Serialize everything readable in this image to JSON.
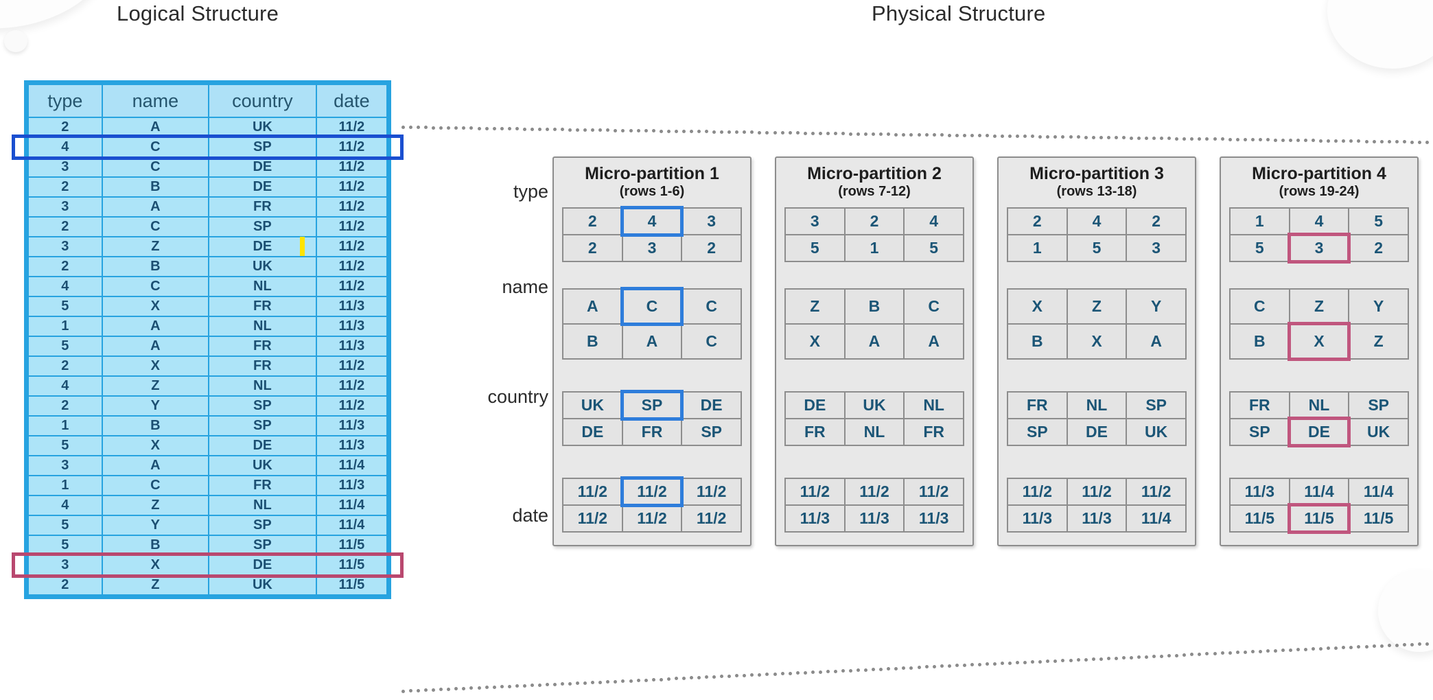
{
  "titles": {
    "logical": "Logical Structure",
    "physical": "Physical Structure"
  },
  "colors": {
    "table_border": "#27a3e0",
    "table_cell": "#ade4f8",
    "table_text": "#1b4f72",
    "highlight_blue": "#1a4fd0",
    "highlight_pink": "#b9486f",
    "partition_bg": "#e8e8e8",
    "caret_yellow": "#ffe400"
  },
  "logical_table": {
    "columns": [
      "type",
      "name",
      "country",
      "date"
    ],
    "rows": [
      {
        "type": "2",
        "name": "A",
        "country": "UK",
        "date": "11/2",
        "highlight": ""
      },
      {
        "type": "4",
        "name": "C",
        "country": "SP",
        "date": "11/2",
        "highlight": "blue"
      },
      {
        "type": "3",
        "name": "C",
        "country": "DE",
        "date": "11/2",
        "highlight": ""
      },
      {
        "type": "2",
        "name": "B",
        "country": "DE",
        "date": "11/2",
        "highlight": ""
      },
      {
        "type": "3",
        "name": "A",
        "country": "FR",
        "date": "11/2",
        "highlight": ""
      },
      {
        "type": "2",
        "name": "C",
        "country": "SP",
        "date": "11/2",
        "highlight": ""
      },
      {
        "type": "3",
        "name": "Z",
        "country": "DE",
        "date": "11/2",
        "highlight": ""
      },
      {
        "type": "2",
        "name": "B",
        "country": "UK",
        "date": "11/2",
        "highlight": ""
      },
      {
        "type": "4",
        "name": "C",
        "country": "NL",
        "date": "11/2",
        "highlight": ""
      },
      {
        "type": "5",
        "name": "X",
        "country": "FR",
        "date": "11/3",
        "highlight": ""
      },
      {
        "type": "1",
        "name": "A",
        "country": "NL",
        "date": "11/3",
        "highlight": ""
      },
      {
        "type": "5",
        "name": "A",
        "country": "FR",
        "date": "11/3",
        "highlight": ""
      },
      {
        "type": "2",
        "name": "X",
        "country": "FR",
        "date": "11/2",
        "highlight": ""
      },
      {
        "type": "4",
        "name": "Z",
        "country": "NL",
        "date": "11/2",
        "highlight": ""
      },
      {
        "type": "2",
        "name": "Y",
        "country": "SP",
        "date": "11/2",
        "highlight": ""
      },
      {
        "type": "1",
        "name": "B",
        "country": "SP",
        "date": "11/3",
        "highlight": ""
      },
      {
        "type": "5",
        "name": "X",
        "country": "DE",
        "date": "11/3",
        "highlight": ""
      },
      {
        "type": "3",
        "name": "A",
        "country": "UK",
        "date": "11/4",
        "highlight": ""
      },
      {
        "type": "1",
        "name": "C",
        "country": "FR",
        "date": "11/3",
        "highlight": ""
      },
      {
        "type": "4",
        "name": "Z",
        "country": "NL",
        "date": "11/4",
        "highlight": ""
      },
      {
        "type": "5",
        "name": "Y",
        "country": "SP",
        "date": "11/4",
        "highlight": ""
      },
      {
        "type": "5",
        "name": "B",
        "country": "SP",
        "date": "11/5",
        "highlight": ""
      },
      {
        "type": "3",
        "name": "X",
        "country": "DE",
        "date": "11/5",
        "highlight": "pink"
      },
      {
        "type": "2",
        "name": "Z",
        "country": "UK",
        "date": "11/5",
        "highlight": ""
      }
    ]
  },
  "physical": {
    "row_labels": [
      "type",
      "name",
      "country",
      "date"
    ],
    "partitions": [
      {
        "title": "Micro-partition 1",
        "subtitle": "(rows 1-6)",
        "columns": {
          "type": [
            [
              "2",
              "4",
              "3"
            ],
            [
              "2",
              "3",
              "2"
            ]
          ],
          "name": [
            [
              "A",
              "C",
              "C"
            ],
            [
              "B",
              "A",
              "C"
            ]
          ],
          "country": [
            [
              "UK",
              "SP",
              "DE"
            ],
            [
              "DE",
              "FR",
              "SP"
            ]
          ],
          "date": [
            [
              "11/2",
              "11/2",
              "11/2"
            ],
            [
              "11/2",
              "11/2",
              "11/2"
            ]
          ]
        },
        "highlights": {
          "type": [
            [
              0,
              1
            ]
          ],
          "name": [
            [
              0,
              1
            ]
          ],
          "country": [
            [
              0,
              1
            ]
          ],
          "date": [
            [
              0,
              1
            ]
          ]
        },
        "highlight_color": "blue"
      },
      {
        "title": "Micro-partition 2",
        "subtitle": "(rows 7-12)",
        "columns": {
          "type": [
            [
              "3",
              "2",
              "4"
            ],
            [
              "5",
              "1",
              "5"
            ]
          ],
          "name": [
            [
              "Z",
              "B",
              "C"
            ],
            [
              "X",
              "A",
              "A"
            ]
          ],
          "country": [
            [
              "DE",
              "UK",
              "NL"
            ],
            [
              "FR",
              "NL",
              "FR"
            ]
          ],
          "date": [
            [
              "11/2",
              "11/2",
              "11/2"
            ],
            [
              "11/3",
              "11/3",
              "11/3"
            ]
          ]
        },
        "highlights": {},
        "highlight_color": ""
      },
      {
        "title": "Micro-partition 3",
        "subtitle": "(rows 13-18)",
        "columns": {
          "type": [
            [
              "2",
              "4",
              "2"
            ],
            [
              "1",
              "5",
              "3"
            ]
          ],
          "name": [
            [
              "X",
              "Z",
              "Y"
            ],
            [
              "B",
              "X",
              "A"
            ]
          ],
          "country": [
            [
              "FR",
              "NL",
              "SP"
            ],
            [
              "SP",
              "DE",
              "UK"
            ]
          ],
          "date": [
            [
              "11/2",
              "11/2",
              "11/2"
            ],
            [
              "11/3",
              "11/3",
              "11/4"
            ]
          ]
        },
        "highlights": {},
        "highlight_color": ""
      },
      {
        "title": "Micro-partition 4",
        "subtitle": "(rows 19-24)",
        "columns": {
          "type": [
            [
              "1",
              "4",
              "5"
            ],
            [
              "5",
              "3",
              "2"
            ]
          ],
          "name": [
            [
              "C",
              "Z",
              "Y"
            ],
            [
              "B",
              "X",
              "Z"
            ]
          ],
          "country": [
            [
              "FR",
              "NL",
              "SP"
            ],
            [
              "SP",
              "DE",
              "UK"
            ]
          ],
          "date": [
            [
              "11/3",
              "11/4",
              "11/4"
            ],
            [
              "11/5",
              "11/5",
              "11/5"
            ]
          ]
        },
        "highlights": {
          "type": [
            [
              1,
              1
            ]
          ],
          "name": [
            [
              1,
              1
            ]
          ],
          "country": [
            [
              1,
              1
            ]
          ],
          "date": [
            [
              1,
              1
            ]
          ]
        },
        "highlight_color": "pink"
      }
    ]
  }
}
